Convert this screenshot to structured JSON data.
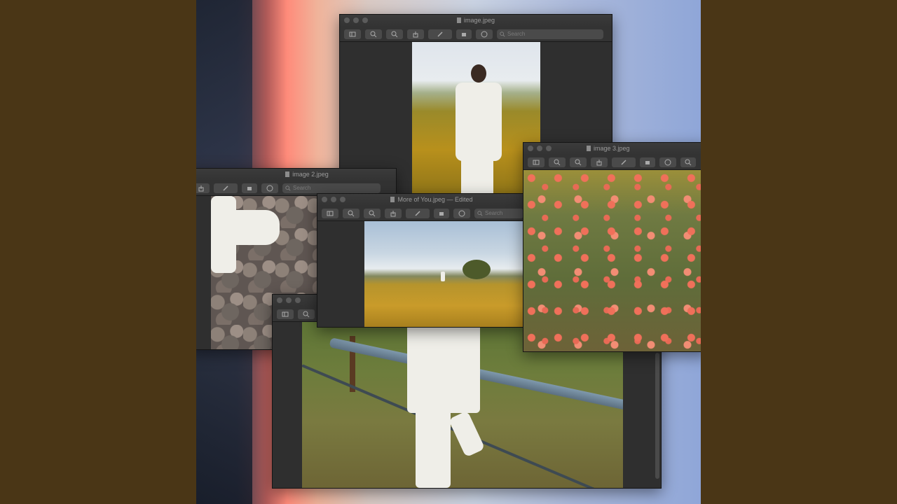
{
  "windows": {
    "main": {
      "title": "image.jpeg",
      "search_placeholder": "Search"
    },
    "image2": {
      "title": "image 2.jpeg",
      "search_placeholder": "Search"
    },
    "edited": {
      "title": "More of You.jpeg — Edited",
      "search_placeholder": "Search"
    },
    "image3": {
      "title": "image 3.jpeg"
    }
  },
  "icons": {
    "sidebar": "sidebar-icon",
    "zoom_out": "zoom-out-icon",
    "zoom_in": "zoom-in-icon",
    "share": "share-icon",
    "markup": "pen-icon",
    "rotate": "rotate-icon",
    "annotate": "annotate-icon",
    "search": "search-icon"
  },
  "colors": {
    "background": "#4a3616",
    "window_chrome": "#2b2b2b",
    "toolbar": "#333333"
  }
}
